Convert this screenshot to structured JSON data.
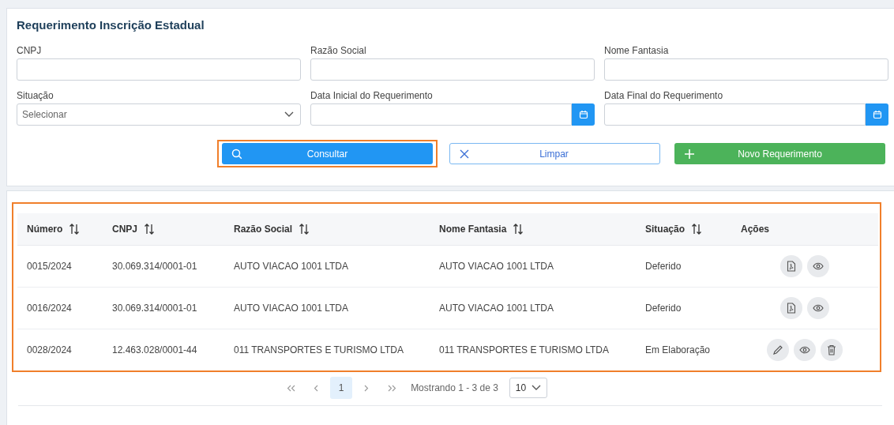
{
  "page_title": "Requerimento Inscrição Estadual",
  "fields": [
    {
      "label": "CNPJ",
      "kind": "text"
    },
    {
      "label": "Razão Social",
      "kind": "text"
    },
    {
      "label": "Nome Fantasia",
      "kind": "text"
    },
    {
      "label": "Situação",
      "kind": "select",
      "placeholder": "Selecionar"
    },
    {
      "label": "Data Inicial do Requerimento",
      "kind": "date"
    },
    {
      "label": "Data Final do Requerimento",
      "kind": "date"
    }
  ],
  "buttons": [
    {
      "label": "Consultar",
      "kind": "search",
      "highlighted": true
    },
    {
      "label": "Limpar",
      "kind": "clear",
      "highlighted": false
    },
    {
      "label": "Novo Requerimento",
      "kind": "add",
      "highlighted": false
    }
  ],
  "table": {
    "highlighted": true,
    "columns": [
      {
        "label": "Número",
        "sortable": true
      },
      {
        "label": "CNPJ",
        "sortable": true
      },
      {
        "label": "Razão Social",
        "sortable": true
      },
      {
        "label": "Nome Fantasia",
        "sortable": true
      },
      {
        "label": "Situação",
        "sortable": true
      },
      {
        "label": "Ações",
        "sortable": false
      }
    ],
    "rows": [
      {
        "cells": [
          "0015/2024",
          "30.069.314/0001-01",
          "AUTO VIACAO 1001 LTDA",
          "AUTO VIACAO 1001 LTDA",
          "Deferido"
        ],
        "actions": [
          {
            "kind": "pdf"
          },
          {
            "kind": "view"
          }
        ]
      },
      {
        "cells": [
          "0016/2024",
          "30.069.314/0001-01",
          "AUTO VIACAO 1001 LTDA",
          "AUTO VIACAO 1001 LTDA",
          "Deferido"
        ],
        "actions": [
          {
            "kind": "pdf"
          },
          {
            "kind": "view"
          }
        ]
      },
      {
        "cells": [
          "0028/2024",
          "12.463.028/0001-44",
          "011 TRANSPORTES E TURISMO LTDA",
          "011 TRANSPORTES E TURISMO LTDA",
          "Em Elaboração"
        ],
        "actions": [
          {
            "kind": "edit"
          },
          {
            "kind": "view"
          },
          {
            "kind": "delete"
          }
        ]
      }
    ]
  },
  "pagination": {
    "pages": [
      {
        "label": "1",
        "selected": true
      }
    ],
    "summary": "Mostrando 1 - 3 de 3",
    "page_size": "10"
  }
}
